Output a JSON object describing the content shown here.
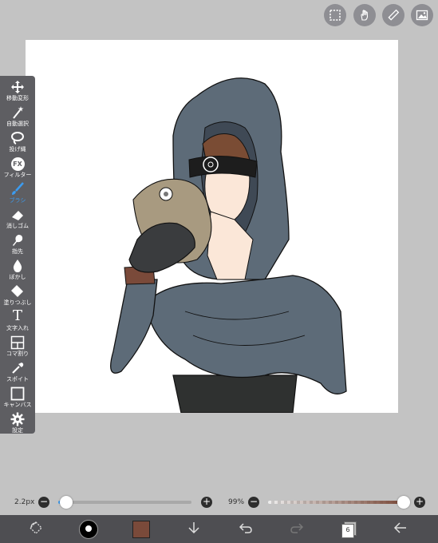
{
  "colors": {
    "workspace": "#c3c3c3",
    "toolbar": "#5e5e62",
    "bottombar": "#4e4e52",
    "accent": "#3c9cf0",
    "brush_color": "#7a4a3a"
  },
  "top_toolbar": [
    "selection-icon",
    "hand-icon",
    "ruler-icon",
    "gallery-icon"
  ],
  "tools": [
    {
      "label": "移動変形",
      "icon": "move-icon"
    },
    {
      "label": "自動選択",
      "icon": "magic-wand-icon"
    },
    {
      "label": "投げ縄",
      "icon": "lasso-icon"
    },
    {
      "label": "フィルター",
      "icon": "fx-icon",
      "icon_text": "FX"
    },
    {
      "label": "ブラシ",
      "icon": "brush-icon",
      "active": true
    },
    {
      "label": "消しゴム",
      "icon": "eraser-icon"
    },
    {
      "label": "指先",
      "icon": "smudge-icon"
    },
    {
      "label": "ぼかし",
      "icon": "blur-icon"
    },
    {
      "label": "塗りつぶし",
      "icon": "fill-icon"
    },
    {
      "label": "文字入れ",
      "icon": "text-icon",
      "icon_text": "T"
    },
    {
      "label": "コマ割り",
      "icon": "frame-divider-icon"
    },
    {
      "label": "スポイト",
      "icon": "eyedropper-icon"
    },
    {
      "label": "キャンバス",
      "icon": "canvas-icon"
    },
    {
      "label": "設定",
      "icon": "settings-icon"
    }
  ],
  "brush": {
    "size_label": "2.2px",
    "size_fraction": 0.06,
    "opacity_label": "99%",
    "opacity_fraction": 0.99,
    "minus": "−",
    "plus": "+"
  },
  "bottom_bar": {
    "layer_count": "6",
    "items": [
      "transform-icon",
      "brush-size-icon",
      "color-swatch",
      "download-icon",
      "undo-icon",
      "redo-icon",
      "layers-icon",
      "back-icon"
    ]
  }
}
